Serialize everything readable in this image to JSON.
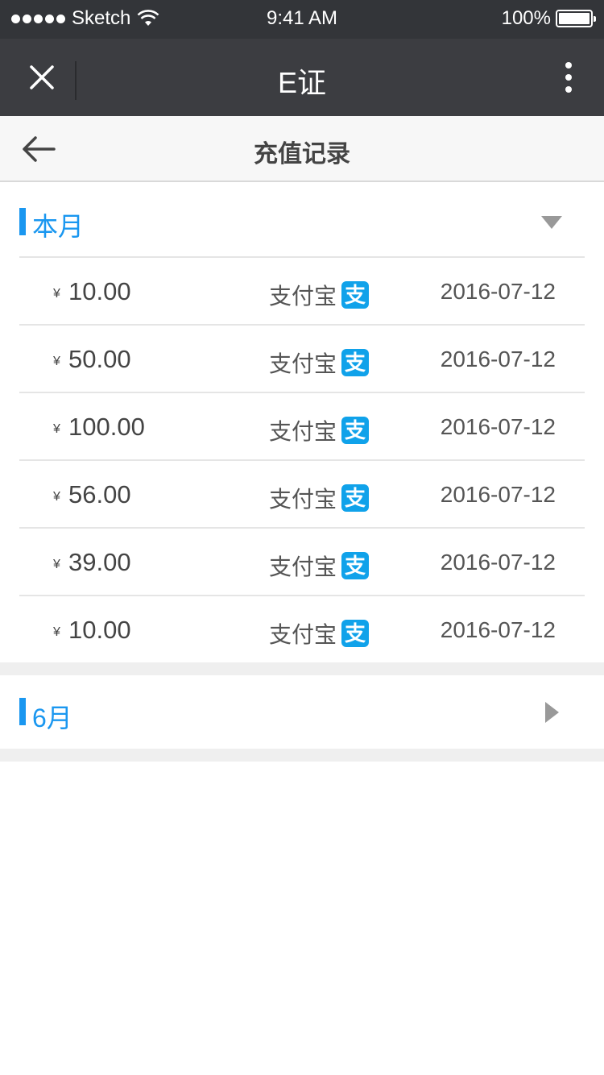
{
  "status_bar": {
    "carrier": "Sketch",
    "time": "9:41 AM",
    "battery": "100%"
  },
  "app_bar": {
    "title": "E证"
  },
  "nav": {
    "title": "充值记录"
  },
  "sections": [
    {
      "title": "本月",
      "expanded": true,
      "records": [
        {
          "currency": "¥",
          "amount": "10.00",
          "method": "支付宝",
          "method_icon": "支",
          "date": "2016-07-12"
        },
        {
          "currency": "¥",
          "amount": "50.00",
          "method": "支付宝",
          "method_icon": "支",
          "date": "2016-07-12"
        },
        {
          "currency": "¥",
          "amount": "100.00",
          "method": "支付宝",
          "method_icon": "支",
          "date": "2016-07-12"
        },
        {
          "currency": "¥",
          "amount": "56.00",
          "method": "支付宝",
          "method_icon": "支",
          "date": "2016-07-12"
        },
        {
          "currency": "¥",
          "amount": "39.00",
          "method": "支付宝",
          "method_icon": "支",
          "date": "2016-07-12"
        },
        {
          "currency": "¥",
          "amount": "10.00",
          "method": "支付宝",
          "method_icon": "支",
          "date": "2016-07-12"
        }
      ]
    },
    {
      "title": "6月",
      "expanded": false
    }
  ],
  "colors": {
    "accent": "#1a97f0",
    "app_bar": "#3c3d41",
    "status_bar": "#333539",
    "alipay": "#10a2ea"
  }
}
